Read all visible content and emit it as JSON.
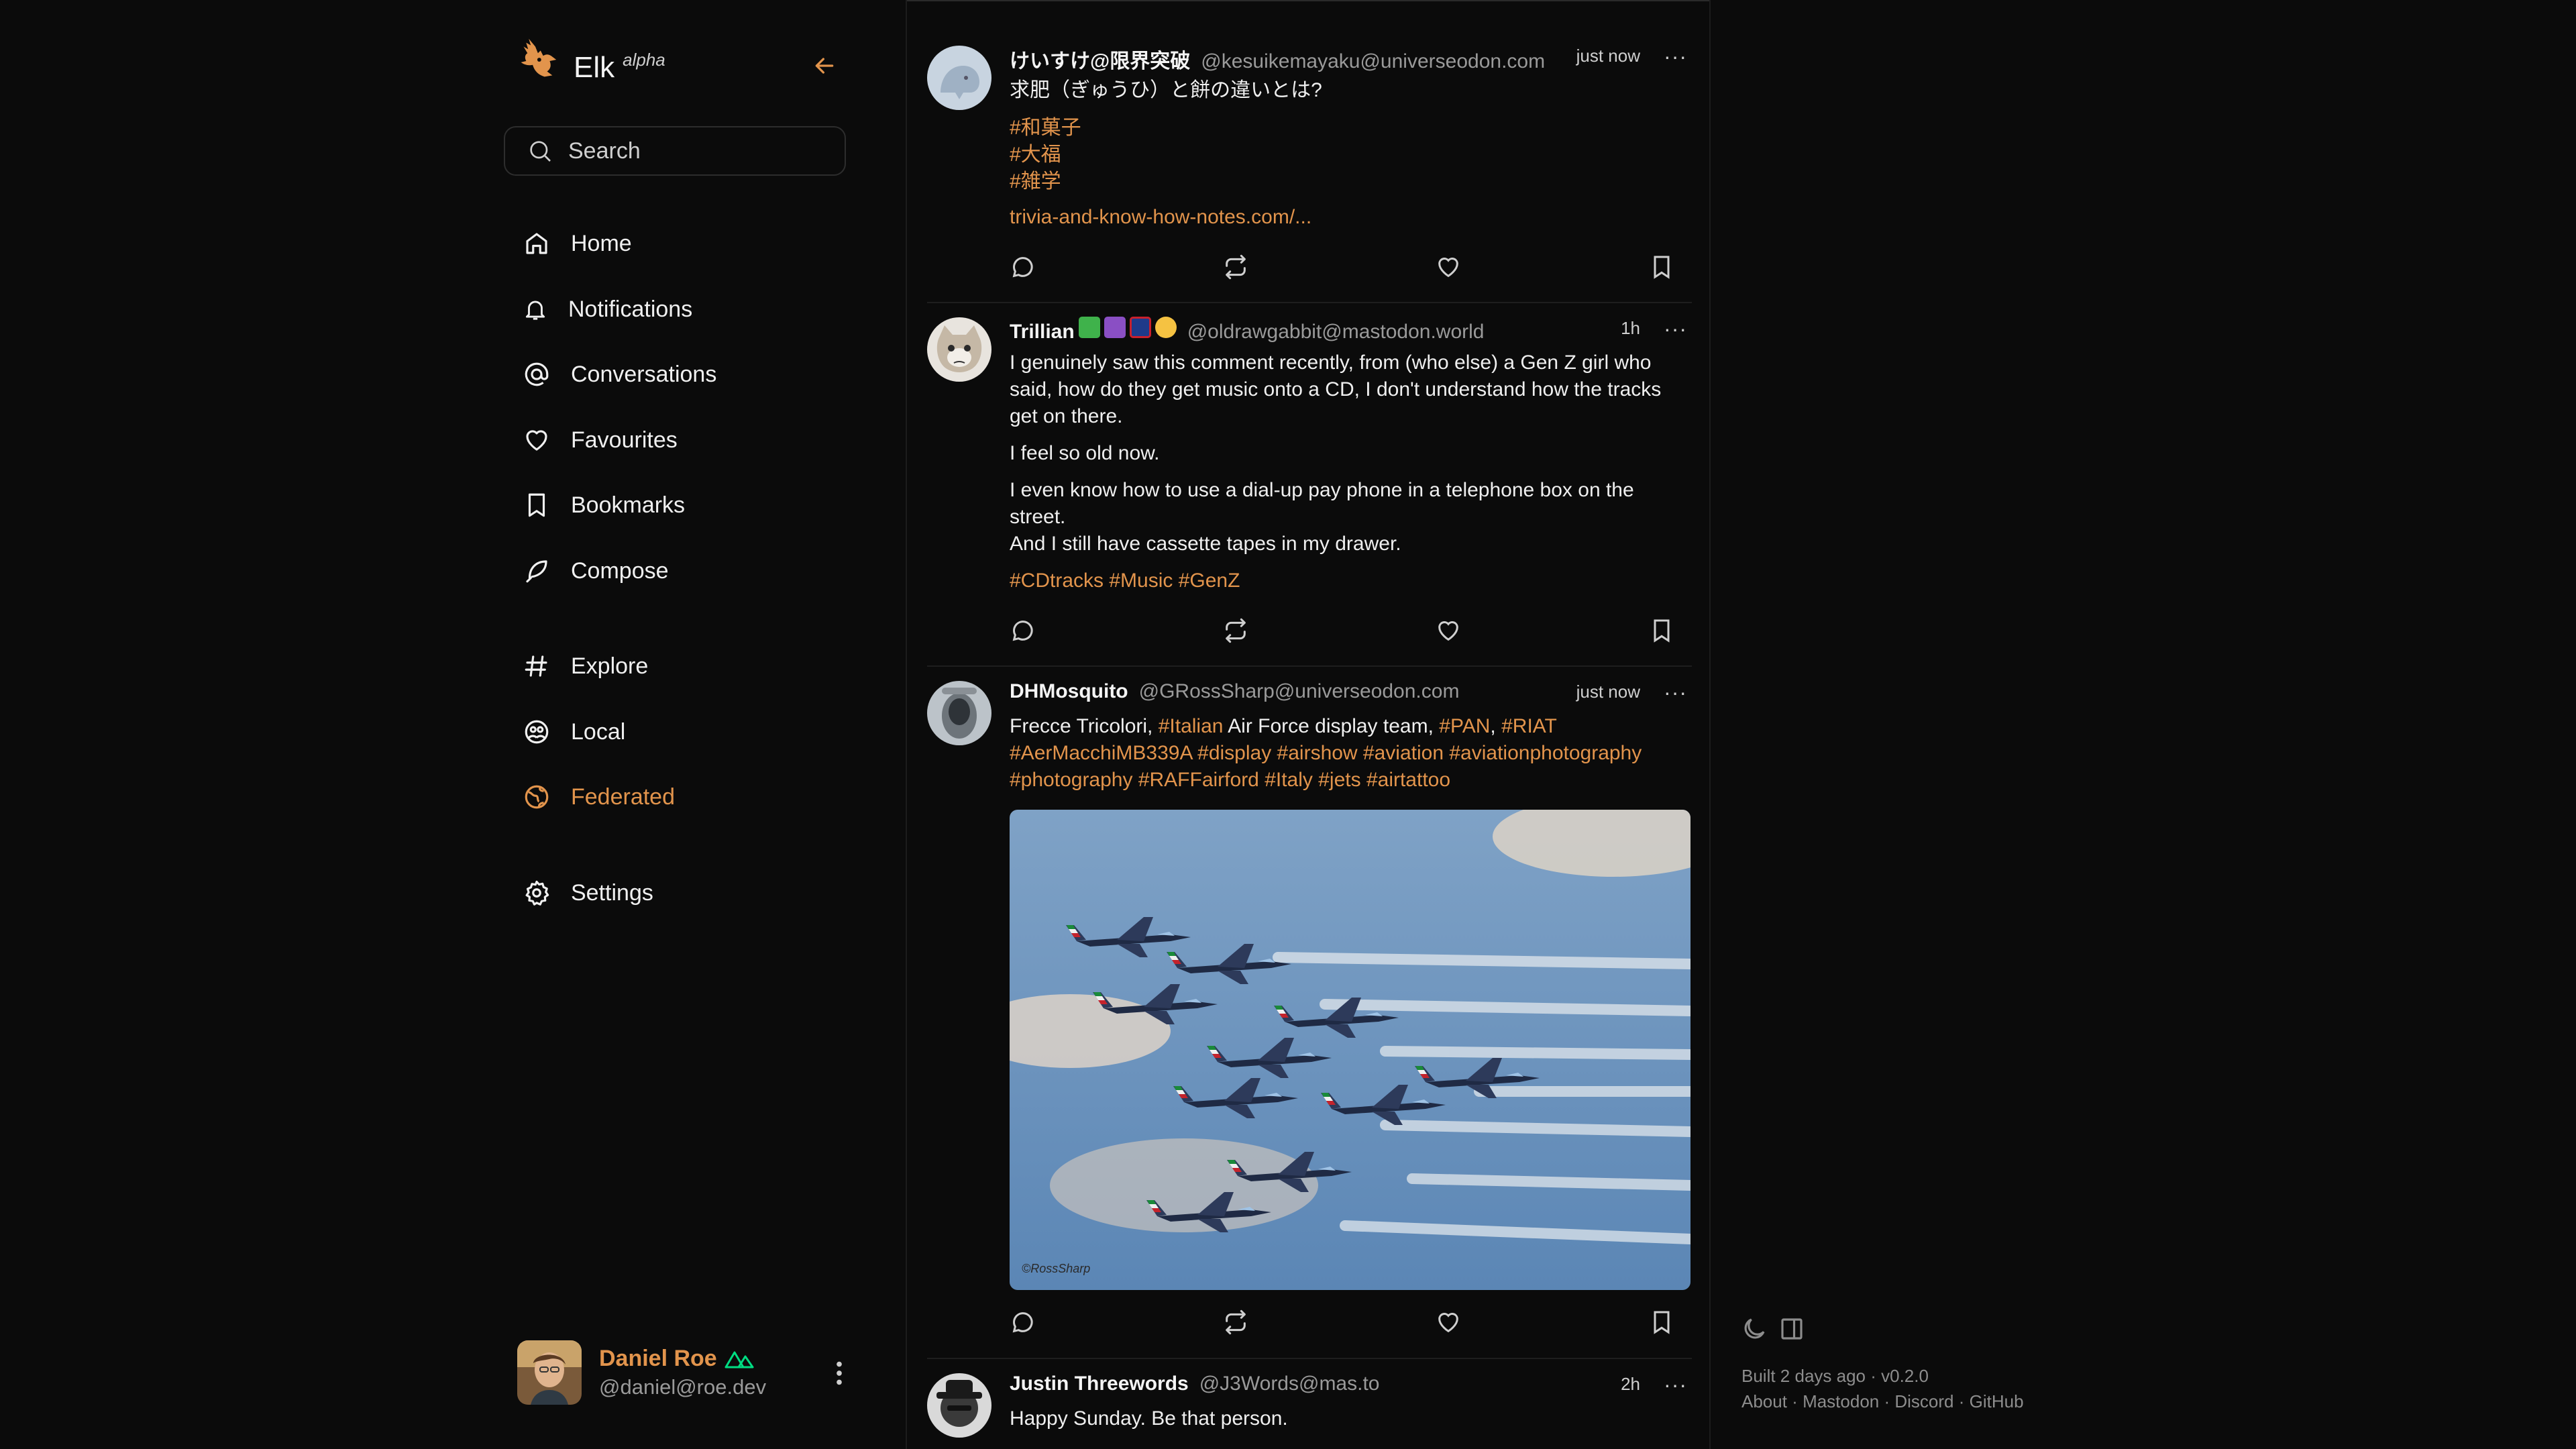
{
  "app": {
    "name": "Elk",
    "tag": "alpha"
  },
  "search": {
    "placeholder": "Search"
  },
  "nav": [
    {
      "label": "Home",
      "icon": "home-icon",
      "active": false
    },
    {
      "label": "Notifications",
      "icon": "bell-icon",
      "active": false
    },
    {
      "label": "Conversations",
      "icon": "at-icon",
      "active": false
    },
    {
      "label": "Favourites",
      "icon": "heart-icon",
      "active": false
    },
    {
      "label": "Bookmarks",
      "icon": "bookmark-icon",
      "active": false
    },
    {
      "label": "Compose",
      "icon": "feather-icon",
      "active": false
    },
    {
      "label": "Explore",
      "icon": "hash-icon",
      "active": false
    },
    {
      "label": "Local",
      "icon": "group-icon",
      "active": false
    },
    {
      "label": "Federated",
      "icon": "globe-icon",
      "active": true
    },
    {
      "label": "Settings",
      "icon": "gear-icon",
      "active": false
    }
  ],
  "user": {
    "name": "Daniel Roe",
    "handle": "@daniel@roe.dev"
  },
  "posts": [
    {
      "display_name": "けいすけ@限界突破",
      "handle": "@kesuikemayaku@universeodon.com",
      "time": "just now",
      "text": "求肥（ぎゅうひ）と餅の違いとは?",
      "tags": [
        "#和菓子",
        "#大福",
        "#雑学"
      ],
      "link": "trivia-and-know-how-notes.com/..."
    },
    {
      "display_name": "Trillian",
      "handle": "@oldrawgabbit@mastodon.world",
      "time": "1h",
      "paragraphs": [
        "I genuinely saw this comment recently, from (who else) a Gen Z girl who said, how do they get music onto a CD, I don't understand how the tracks get on there.",
        "I feel so old now.",
        "I even know how to use a dial-up pay phone in a telephone box on the street.",
        "And I still have cassette tapes in my drawer."
      ],
      "tags_line": "#CDtracks #Music #GenZ"
    },
    {
      "display_name": "DHMosquito",
      "handle": "@GRossSharp@universeodon.com",
      "time": "just now",
      "text_parts": [
        "Frecce Tricolori, ",
        "#Italian",
        " Air Force display team, ",
        "#PAN",
        ", ",
        "#RIAT"
      ],
      "tags_line": "#AerMacchiMB339A #display #airshow #aviation #aviationphotography #photography #RAFFairford #Italy #jets #airtattoo",
      "image_credit": "©RossSharp"
    },
    {
      "display_name": "Justin Threewords",
      "handle": "@J3Words@mas.to",
      "time": "2h",
      "text": "Happy Sunday. Be that person."
    }
  ],
  "footer": {
    "built": "Built 2 days ago · v0.2.0",
    "links": [
      "About",
      "Mastodon",
      "Discord",
      "GitHub"
    ],
    "separator": " · "
  },
  "colors": {
    "accent": "#e2944c",
    "background": "#0b0b0b",
    "text": "#e9e9e9",
    "muted": "#9a9a9a"
  }
}
